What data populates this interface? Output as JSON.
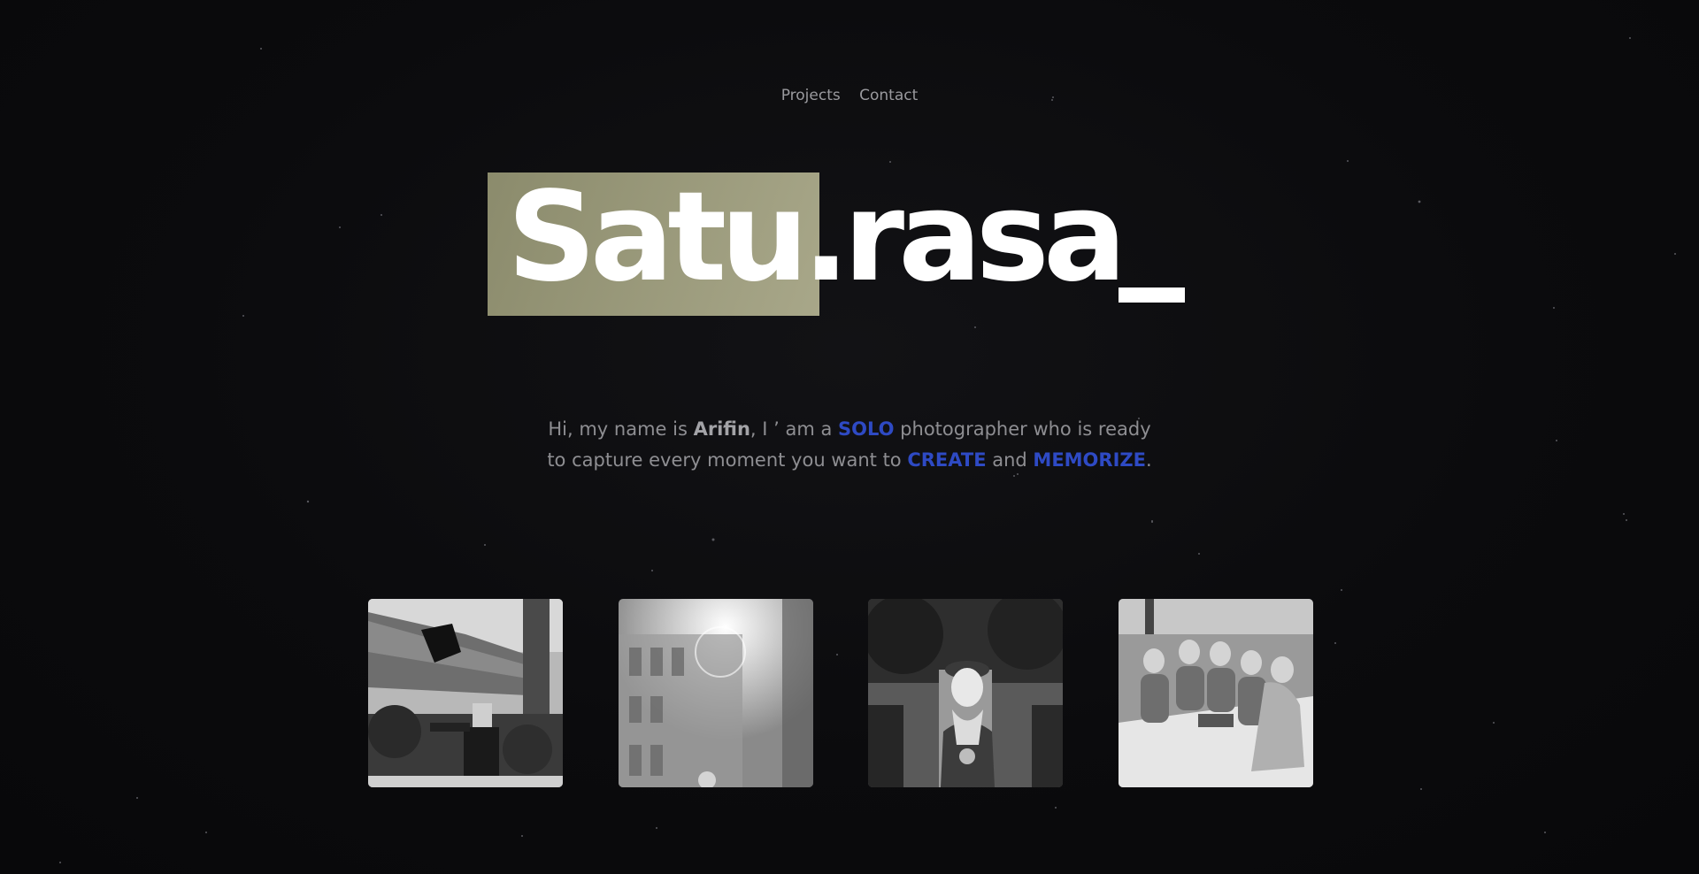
{
  "nav": {
    "items": [
      {
        "label": "Projects"
      },
      {
        "label": "Contact"
      }
    ]
  },
  "hero": {
    "brand_text": "Satu.rasa"
  },
  "intro": {
    "line1_a": "Hi, my name is ",
    "name": "Arifin",
    "line1_b": ", I ’ am a ",
    "solo": "SOLO",
    "line1_c": " photographer who is ready",
    "line2_a": "to capture every moment you want to ",
    "create": "CREATE",
    "line2_b": " and ",
    "memorize": "MEMORIZE",
    "line2_c": "."
  },
  "gallery": {
    "photos": [
      {
        "icon": "graduation-photo-image"
      },
      {
        "icon": "building-sunlight-photo-image"
      },
      {
        "icon": "portrait-flower-photo-image"
      },
      {
        "icon": "group-picnic-photo-image"
      }
    ]
  },
  "colors": {
    "background": "#0b0b0d",
    "highlight": "#9a9a7a",
    "accent_blue": "#2e4ac4",
    "text_muted": "#8e8e92"
  }
}
